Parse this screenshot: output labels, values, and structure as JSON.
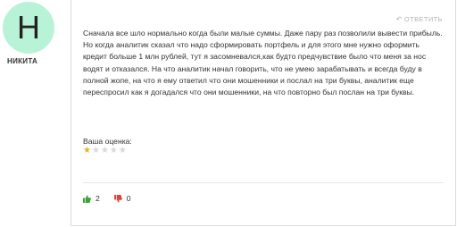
{
  "author": {
    "initial": "Н",
    "name": "НИКИТА",
    "avatar_color": "#b8f3d8"
  },
  "comment": {
    "reply_label": "ОТВЕТИТЬ",
    "text": "Сначала все шло нормально когда были малые суммы. Даже пару раз позволили вывести прибыль. Но когда аналитик сказал что надо сформировать портфель и для этого мне нужно оформить кредит больше 1 млн рублей, тут я засомневался,как будто предчувствие было что меня за нос водят и отказался. На что аналитик начал говорить, что не умею зарабатывать и всегда буду в полной жопе, на что я ему ответил что они мошенники и послал на три буквы, аналитик еще переспросил как я догадался что они мошенники, на что повторно был послан на три буквы.",
    "rating_label": "Ваша оценка:",
    "rating": 1,
    "rating_max": 5,
    "likes": "2",
    "dislikes": "0"
  },
  "colors": {
    "like": "#3aa335",
    "dislike": "#e0453a",
    "star_filled": "#e2b321",
    "star_empty": "#d8d8d8"
  },
  "icons": {
    "reply": "reply-arrow-icon",
    "like": "thumbs-up-icon",
    "dislike": "thumbs-down-icon"
  }
}
